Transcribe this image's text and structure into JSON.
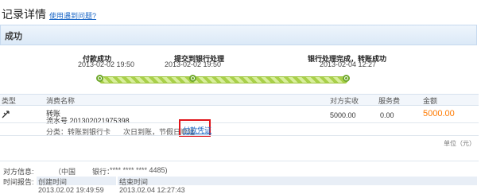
{
  "header": {
    "title": "记录详情",
    "help_link": "使用遇到问题?"
  },
  "status": {
    "label": "成功"
  },
  "steps": [
    {
      "title": "付款成功",
      "date": "2013-02-02 19:50"
    },
    {
      "title": "提交到银行处理",
      "date": "2013-02-02 19:50"
    },
    {
      "title": "银行处理完成，转账成功",
      "date": "2013-02-04 12:27"
    }
  ],
  "table": {
    "headers": {
      "type": "类型",
      "name": "消费名称",
      "counterparty": "对方实收",
      "fee": "服务费",
      "amount": "金额"
    },
    "row": {
      "type_icon": "transfer-icon",
      "name": "转账",
      "serial": "流水号 201302021975398",
      "counterparty": "5000.00",
      "fee": "0.00",
      "amount": "5000.00"
    },
    "detail": {
      "category": "分类：转账到银行卡",
      "arrival": "次日到账，节假日顺延",
      "voucher_link": "付款凭证"
    },
    "unit": "单位（元）"
  },
  "party_info": {
    "label": "对方信息:",
    "country": "（中国",
    "bank_label": "银行：",
    "bank_account": "**** **** **** 4485)"
  },
  "time_report": {
    "label": "时间报告:",
    "col_created": "创建时间",
    "col_ended": "结束时间",
    "created": "2013.02.02 19:49:59",
    "ended": "2013.02.04 12:27:43"
  },
  "colors": {
    "amount": "#ff7a00",
    "link": "#1a66c6",
    "progress": "#a9d04a",
    "highlight_box": "#e0151b"
  }
}
